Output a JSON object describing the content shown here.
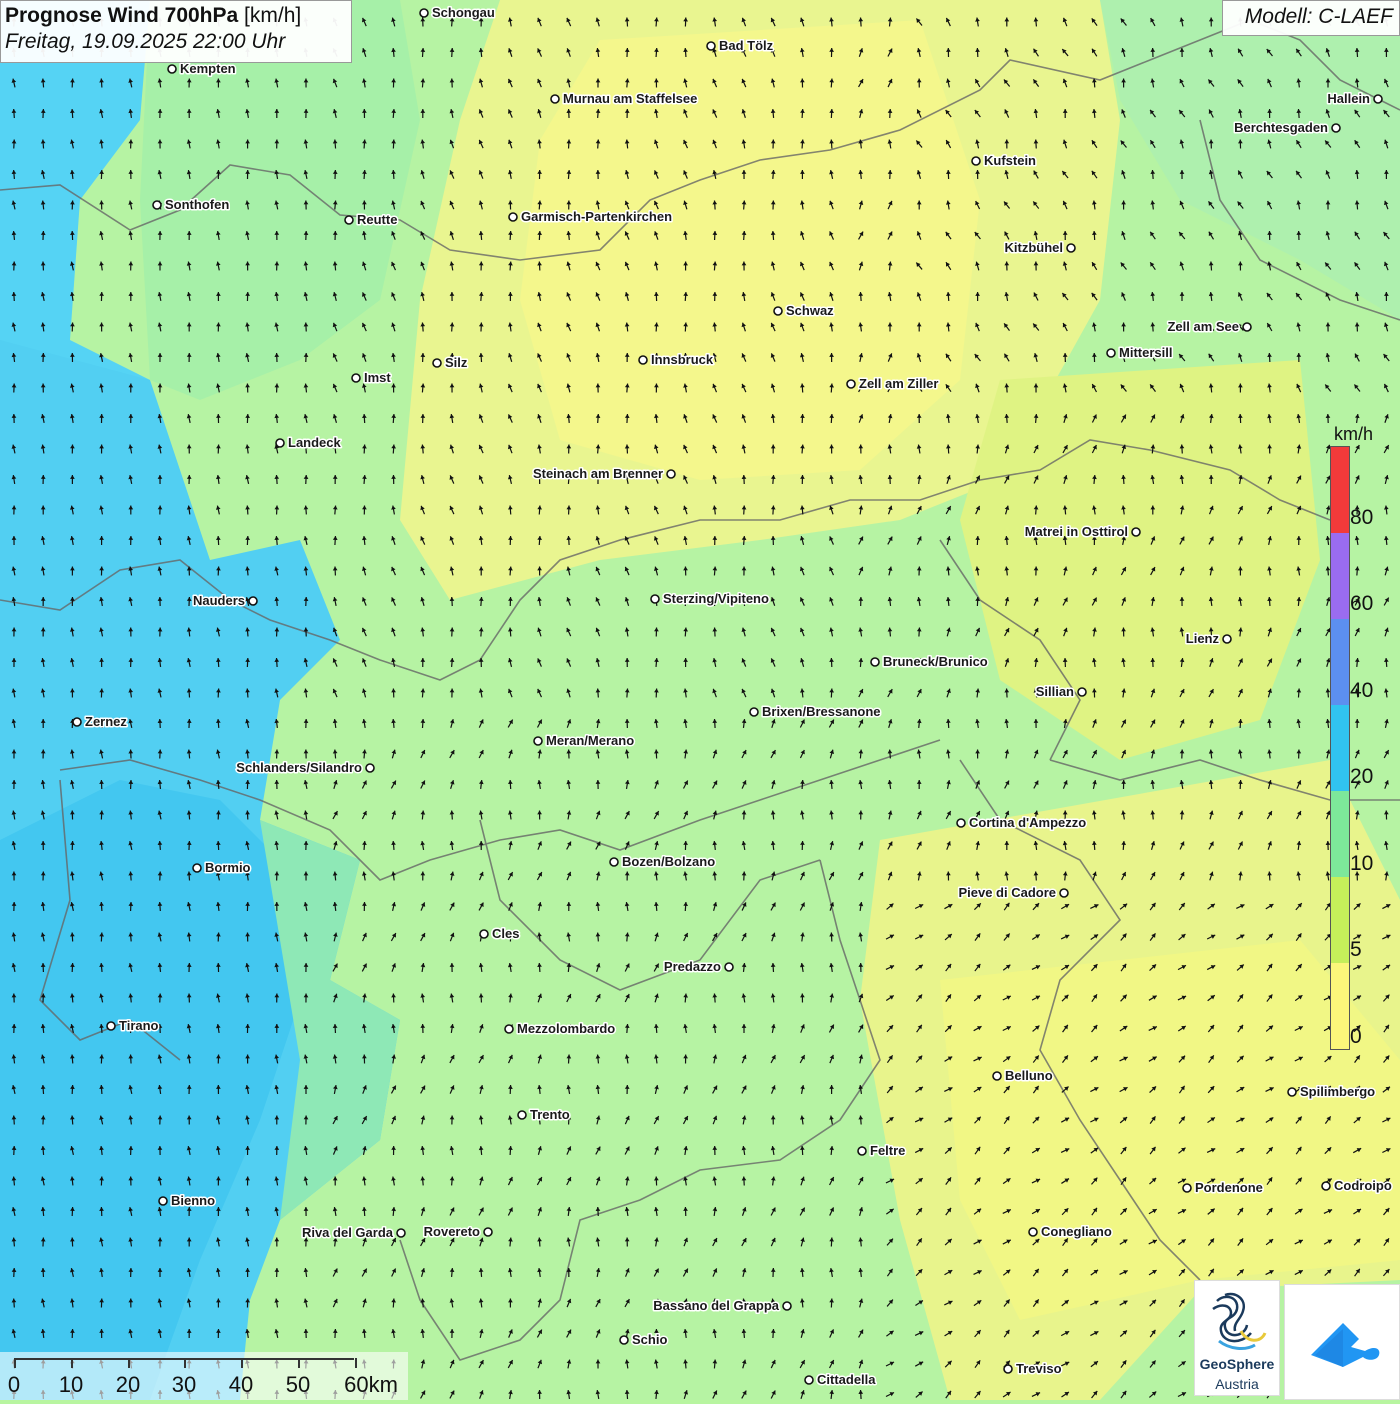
{
  "header": {
    "title_bold": "Prognose Wind 700hPa",
    "title_unit": " [km/h]",
    "datetime": "Freitag, 19.09.2025 22:00 Uhr",
    "model": "Modell: C-LAEF"
  },
  "legend": {
    "unit": "km/h",
    "labels": [
      "80",
      "60",
      "40",
      "20",
      "10",
      "5",
      "0"
    ],
    "colors": [
      "#f23a3a",
      "#9a6cf0",
      "#5c8ff0",
      "#31c3f0",
      "#7de89a",
      "#c6ef5a",
      "#fcf77a"
    ]
  },
  "scale_bar": {
    "labels": [
      "0",
      "10",
      "20",
      "30",
      "40",
      "50",
      "60km"
    ]
  },
  "logos": {
    "geosphere_name": "GeoSphere",
    "geosphere_sub": "Austria",
    "app_icon": "cloud-arrow-icon"
  },
  "cities": [
    {
      "name": "Schongau"
    },
    {
      "name": "Bad Tölz"
    },
    {
      "name": "Kempten"
    },
    {
      "name": "Murnau am Staffelsee"
    },
    {
      "name": "Hallein"
    },
    {
      "name": "Berchtesgaden"
    },
    {
      "name": "Kufstein"
    },
    {
      "name": "Sonthofen"
    },
    {
      "name": "Reutte"
    },
    {
      "name": "Garmisch-Partenkirchen"
    },
    {
      "name": "Kitzbühel"
    },
    {
      "name": "Schwaz"
    },
    {
      "name": "Zell am See"
    },
    {
      "name": "Mittersill"
    },
    {
      "name": "Silz"
    },
    {
      "name": "Innsbruck"
    },
    {
      "name": "Imst"
    },
    {
      "name": "Zell am Ziller"
    },
    {
      "name": "Landeck"
    },
    {
      "name": "Steinach am Brenner"
    },
    {
      "name": "Matrei in Osttirol"
    },
    {
      "name": "Nauders"
    },
    {
      "name": "Sterzing/Vipiteno"
    },
    {
      "name": "Lienz"
    },
    {
      "name": "Bruneck/Brunico"
    },
    {
      "name": "Sillian"
    },
    {
      "name": "Brixen/Bressanone"
    },
    {
      "name": "Zernez"
    },
    {
      "name": "Meran/Merano"
    },
    {
      "name": "Schlanders/Silandro"
    },
    {
      "name": "Cortina d'Ampezzo"
    },
    {
      "name": "Bozen/Bolzano"
    },
    {
      "name": "Bormio"
    },
    {
      "name": "Pieve di Cadore"
    },
    {
      "name": "Cles"
    },
    {
      "name": "Predazzo"
    },
    {
      "name": "Tirano"
    },
    {
      "name": "Mezzolombardo"
    },
    {
      "name": "Belluno"
    },
    {
      "name": "Spilimbergo"
    },
    {
      "name": "Trento"
    },
    {
      "name": "Feltre"
    },
    {
      "name": "Pordenone"
    },
    {
      "name": "Codroipo"
    },
    {
      "name": "Bienno"
    },
    {
      "name": "Riva del Garda"
    },
    {
      "name": "Rovereto"
    },
    {
      "name": "Conegliano"
    },
    {
      "name": "Bassano del Grappa"
    },
    {
      "name": "Schio"
    },
    {
      "name": "Treviso"
    },
    {
      "name": "Cittadella"
    }
  ]
}
